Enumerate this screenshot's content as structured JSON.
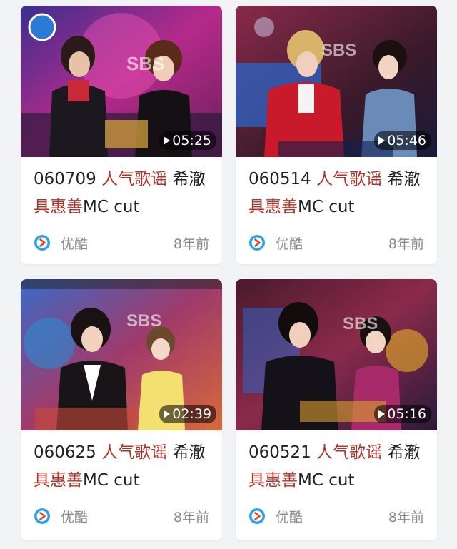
{
  "videos": [
    {
      "date": "060709",
      "show": "人气歌谣",
      "artist": "希澈",
      "host": "具惠善",
      "suffix": "MC cut",
      "duration": "05:25",
      "source": "优酷",
      "age": "8年前"
    },
    {
      "date": "060514",
      "show": "人气歌谣",
      "artist": "希澈",
      "host": "具惠善",
      "suffix": "MC cut",
      "duration": "05:46",
      "source": "优酷",
      "age": "8年前"
    },
    {
      "date": "060625",
      "show": "人气歌谣",
      "artist": "希澈",
      "host": "具惠善",
      "suffix": "MC cut",
      "duration": "02:39",
      "source": "优酷",
      "age": "8年前"
    },
    {
      "date": "060521",
      "show": "人气歌谣",
      "artist": "希澈",
      "host": "具惠善",
      "suffix": "MC cut",
      "duration": "05:16",
      "source": "优酷",
      "age": "8年前"
    }
  ],
  "thumb_text": {
    "logo": "SBS"
  },
  "colors": {
    "highlight": "#b0332a",
    "youku_blue": "#2aa3e8",
    "youku_red": "#e8432a"
  }
}
